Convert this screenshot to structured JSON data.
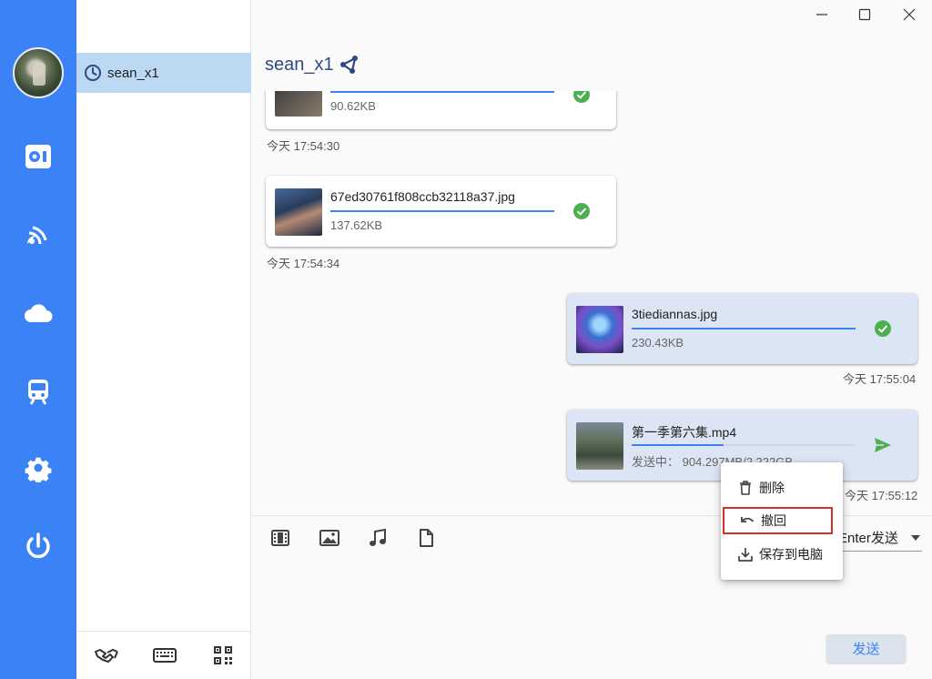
{
  "sidebar": {
    "nav": [
      "transfer-icon",
      "satellite-icon",
      "cloud-icon",
      "train-icon",
      "settings-icon",
      "power-icon"
    ]
  },
  "contacts": {
    "items": [
      {
        "name": "sean_x1"
      }
    ],
    "bottom_icons": [
      "handshake-icon",
      "keyboard-icon",
      "qrcode-icon"
    ]
  },
  "chat": {
    "title": "sean_x1",
    "messages": [
      {
        "file_name": "",
        "size": "90.62KB",
        "progress": 1.0,
        "status": "done",
        "time": "今天 17:54:30",
        "side": "left"
      },
      {
        "file_name": "67ed30761f808ccb32118a37.jpg",
        "size": "137.62KB",
        "progress": 1.0,
        "status": "done",
        "time": "今天 17:54:34",
        "side": "left"
      },
      {
        "file_name": "3tiediannas.jpg",
        "size": "230.43KB",
        "progress": 1.0,
        "status": "done",
        "time": "今天 17:55:04",
        "side": "right"
      },
      {
        "file_name": "第一季第六集.mp4",
        "size": "发送中： 904.297MB/2.222GB",
        "progress": 0.41,
        "status": "sending",
        "time": "今天 17:55:12",
        "side": "right"
      }
    ]
  },
  "toolbar": {
    "icons": [
      "video-icon",
      "image-icon",
      "music-icon",
      "file-icon"
    ],
    "send_mode": "Enter发送"
  },
  "send_button": "发送",
  "context_menu": {
    "items": [
      "删除",
      "撤回",
      "保存到电脑"
    ],
    "highlighted": "撤回"
  },
  "colors": {
    "accent": "#3b82f6",
    "done": "#4caf50",
    "highlight_border": "#d32f2f",
    "selected_contact": "#bcd9f4"
  }
}
